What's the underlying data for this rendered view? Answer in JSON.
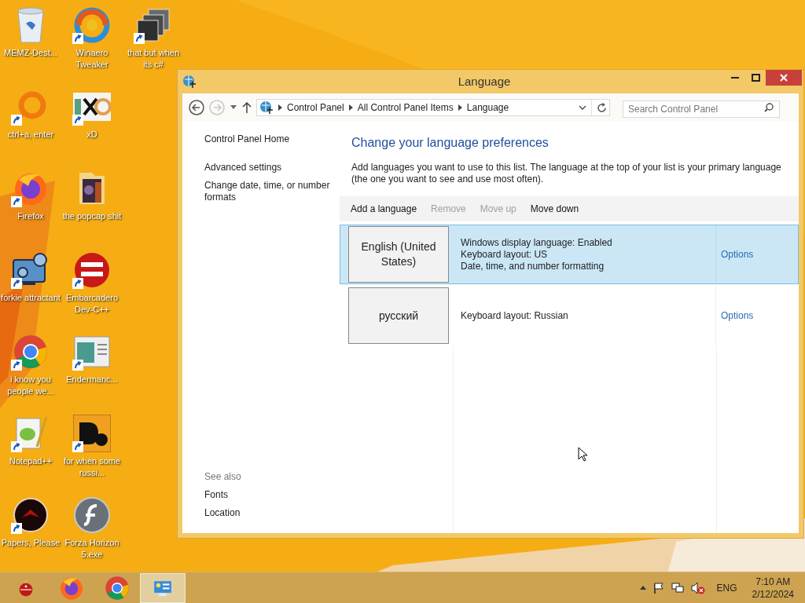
{
  "desktop": {
    "icons": [
      {
        "label": "MEMZ-Dest...",
        "kind": "bin",
        "shortcut": false
      },
      {
        "label": "Winaero Tweaker",
        "kind": "swirl",
        "shortcut": true
      },
      {
        "label": "that but when its c#",
        "kind": "stack",
        "shortcut": true
      },
      {
        "label": "ctrl+a, enter",
        "kind": "ring",
        "shortcut": true
      },
      {
        "label": "xD",
        "kind": "hex",
        "shortcut": true
      },
      {
        "label": "Firefox",
        "kind": "firefox",
        "shortcut": true
      },
      {
        "label": "the popcap shit",
        "kind": "folder",
        "shortcut": false
      },
      {
        "label": "forkie attractant",
        "kind": "monitor",
        "shortcut": true
      },
      {
        "label": "Embarcadero Dev-C++",
        "kind": "devcpp",
        "shortcut": true
      },
      {
        "label": "i know you people we...",
        "kind": "chrome",
        "shortcut": true
      },
      {
        "label": "Endermanc...",
        "kind": "window",
        "shortcut": true
      },
      {
        "label": "Notepad++",
        "kind": "notepad",
        "shortcut": true
      },
      {
        "label": "for when some russi...",
        "kind": "de",
        "shortcut": true
      },
      {
        "label": "Papers, Please",
        "kind": "disc",
        "shortcut": true
      },
      {
        "label": "Forza Horizon 5.exe",
        "kind": "flash",
        "shortcut": false
      }
    ]
  },
  "window": {
    "title": "Language",
    "nav": {
      "back_disabled": false,
      "forward_disabled": true
    },
    "breadcrumbs": [
      "Control Panel",
      "All Control Panel Items",
      "Language"
    ],
    "search": {
      "placeholder": "Search Control Panel"
    },
    "sidebar": {
      "links": [
        "Control Panel Home",
        "Advanced settings",
        "Change date, time, or number formats"
      ],
      "see_also_heading": "See also",
      "see_also": [
        "Fonts",
        "Location"
      ]
    },
    "heading": "Change your language preferences",
    "description": "Add languages you want to use to this list. The language at the top of your list is your primary language (the one you want to see and use most often).",
    "toolbar": [
      {
        "label": "Add a language",
        "disabled": false
      },
      {
        "label": "Remove",
        "disabled": true
      },
      {
        "label": "Move up",
        "disabled": true
      },
      {
        "label": "Move down",
        "disabled": false
      }
    ],
    "languages": [
      {
        "name": "English (United States)",
        "details": [
          "Windows display language: Enabled",
          "Keyboard layout: US",
          "Date, time, and number formatting"
        ],
        "options": "Options",
        "selected": true
      },
      {
        "name": "русский",
        "details": [
          "Keyboard layout: Russian"
        ],
        "options": "Options",
        "selected": false
      }
    ]
  },
  "taskbar": {
    "apps": [
      {
        "kind": "ornament",
        "selected": false
      },
      {
        "kind": "firefox",
        "selected": false
      },
      {
        "kind": "chrome",
        "selected": false
      },
      {
        "kind": "control-panel",
        "selected": true
      }
    ],
    "tray": {
      "muted": true,
      "language": "ENG",
      "time": "7:10 AM",
      "date": "2/12/2024"
    }
  }
}
